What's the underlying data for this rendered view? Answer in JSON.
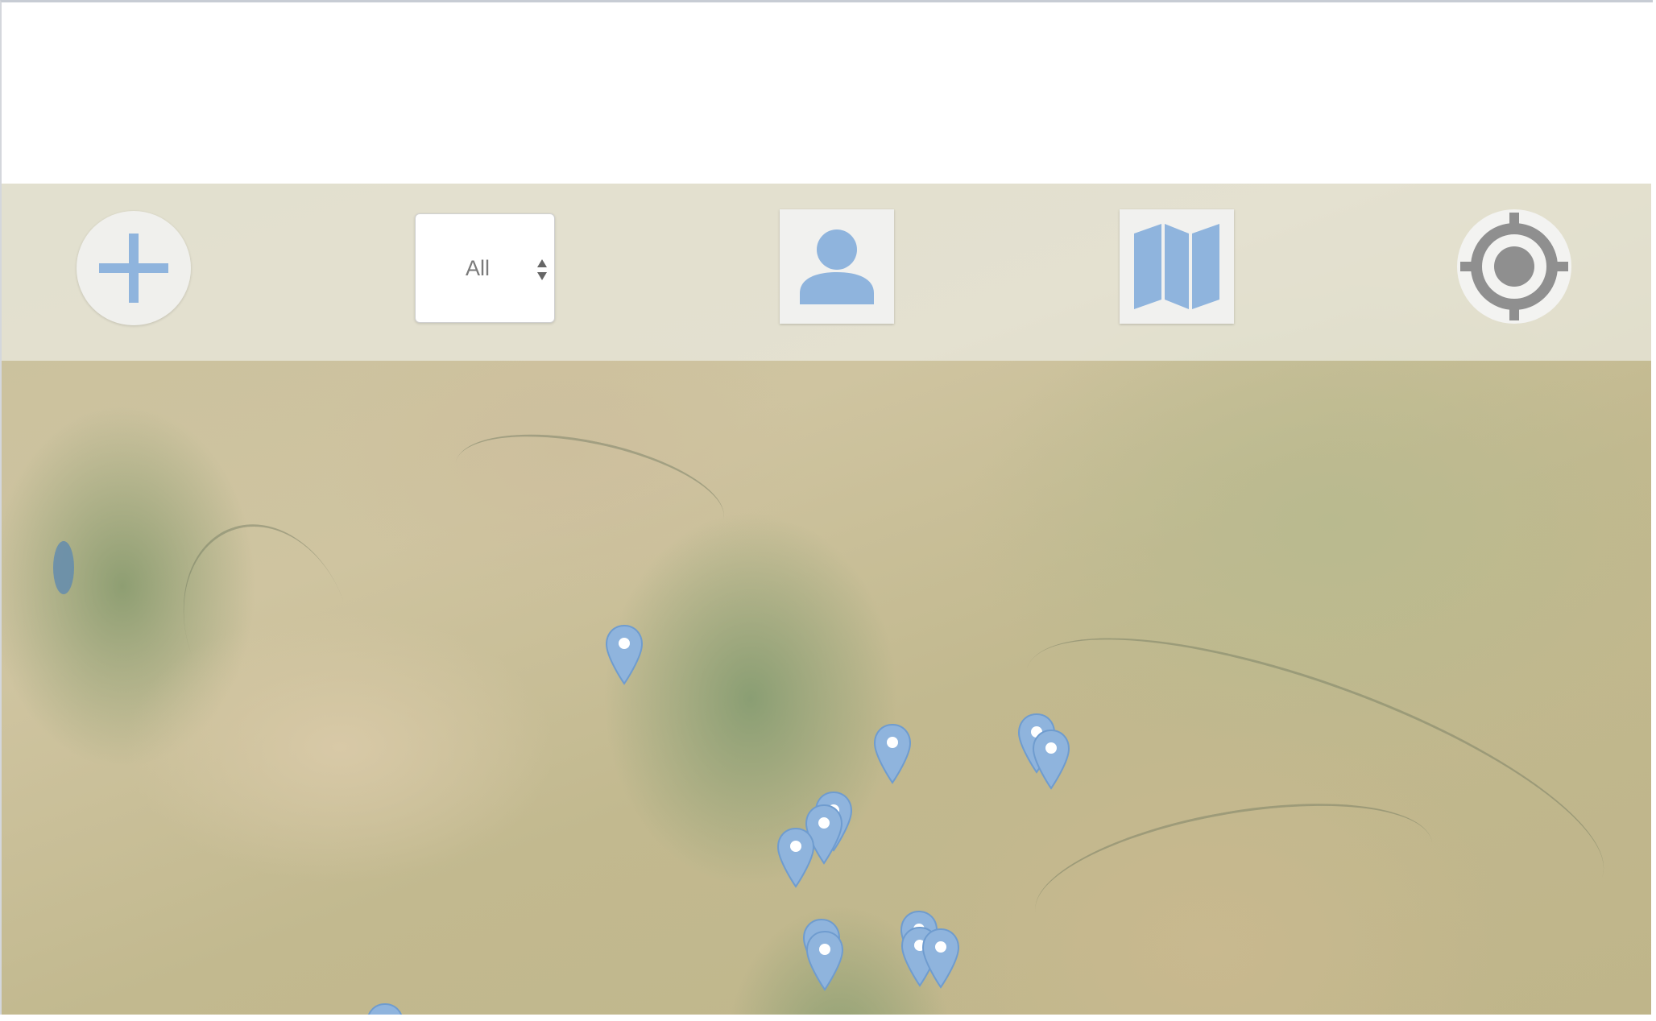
{
  "toolbar": {
    "add_button": {
      "icon": "plus-icon",
      "label": ""
    },
    "filter_select": {
      "value": "All",
      "options": [
        "All"
      ]
    },
    "profile_button": {
      "icon": "user-icon"
    },
    "map_layers_button": {
      "icon": "map-icon"
    },
    "locate_button": {
      "icon": "crosshair-icon"
    }
  },
  "map": {
    "marker_icon": "map-pin-icon",
    "marker_count": 15
  },
  "colors": {
    "accent": "#8fb4dd",
    "locate_icon": "#8f8f8f",
    "toolbar_background": "#ececE2"
  }
}
